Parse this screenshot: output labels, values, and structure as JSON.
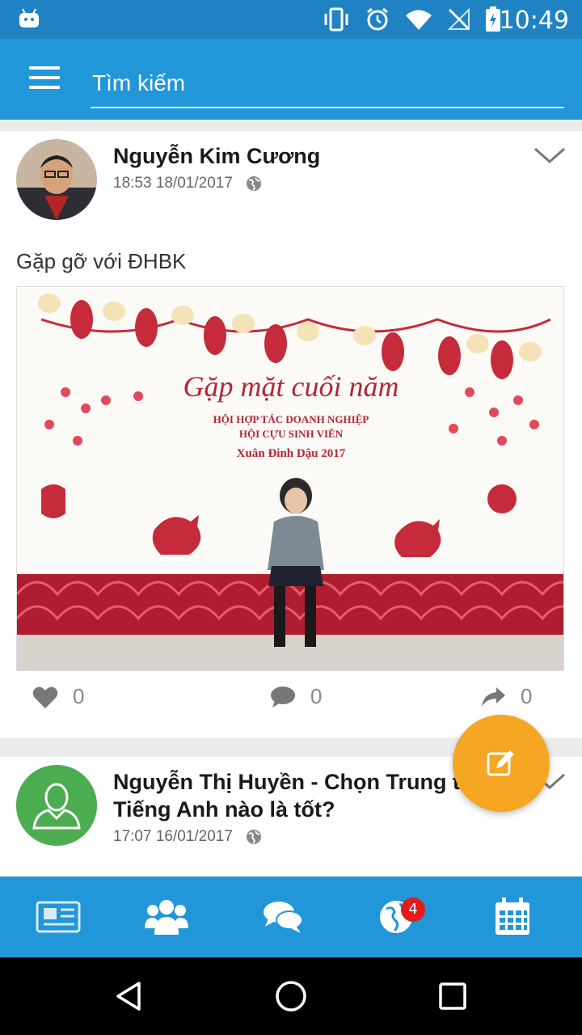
{
  "status_bar": {
    "time": "10:49",
    "icons": [
      "android-icon",
      "vibrate-icon",
      "alarm-icon",
      "wifi-icon",
      "no-sim-icon",
      "battery-charging-icon"
    ]
  },
  "app_bar": {
    "menu_icon": "hamburger-menu-icon",
    "search_placeholder": "Tìm kiếm"
  },
  "feed": [
    {
      "author": "Nguyễn Kim Cương",
      "timestamp": "18:53 18/01/2017",
      "visibility_icon": "globe-icon",
      "text": "Gặp gỡ với ĐHBK",
      "photo_banner": {
        "line1": "Gặp mặt cuối năm",
        "line2": "HỘI HỢP TÁC DOANH NGHIỆP",
        "line3": "HỘI CỰU SINH VIÊN",
        "line4": "Xuân Đinh Dậu 2017"
      },
      "likes": "0",
      "comments": "0",
      "shares": "0"
    },
    {
      "author_line1": "Nguyễn Thị Huyền - Chọn Trung tâ",
      "author_line2": "Tiếng Anh nào là tốt?",
      "timestamp": "17:07 16/01/2017",
      "visibility_icon": "globe-icon"
    }
  ],
  "fab": {
    "icon": "edit-icon",
    "color": "#f5a623"
  },
  "bottom_nav": {
    "items": [
      "news-icon",
      "group-icon",
      "chat-icon",
      "globe-icon",
      "calendar-icon"
    ],
    "notification_badge": "4"
  },
  "colors": {
    "primary": "#2196d8",
    "status_bar": "#1f83c3",
    "accent": "#f5a623",
    "badge": "#e21b1b"
  }
}
